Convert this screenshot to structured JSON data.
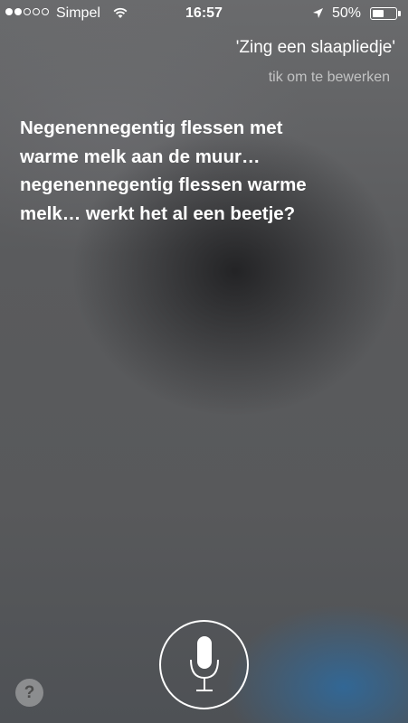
{
  "status_bar": {
    "signal_bars_filled": 2,
    "signal_bars_total": 5,
    "carrier": "Simpel",
    "wifi_icon": "wifi-icon",
    "time": "16:57",
    "location_icon": "location-arrow-icon",
    "battery_percent": "50%",
    "battery_level": 0.5
  },
  "siri": {
    "query": "'Zing een slaapliedje'",
    "edit_hint": "tik om te bewerken",
    "response": "Negenennegentig flessen met warme melk aan de muur… negenennegentig flessen warme melk… werkt het al een beetje?"
  },
  "controls": {
    "mic_icon": "microphone-icon",
    "help_label": "?"
  },
  "colors": {
    "text": "#ffffff",
    "edit_hint": "#b4b5b6",
    "background": "#5e5f60"
  }
}
